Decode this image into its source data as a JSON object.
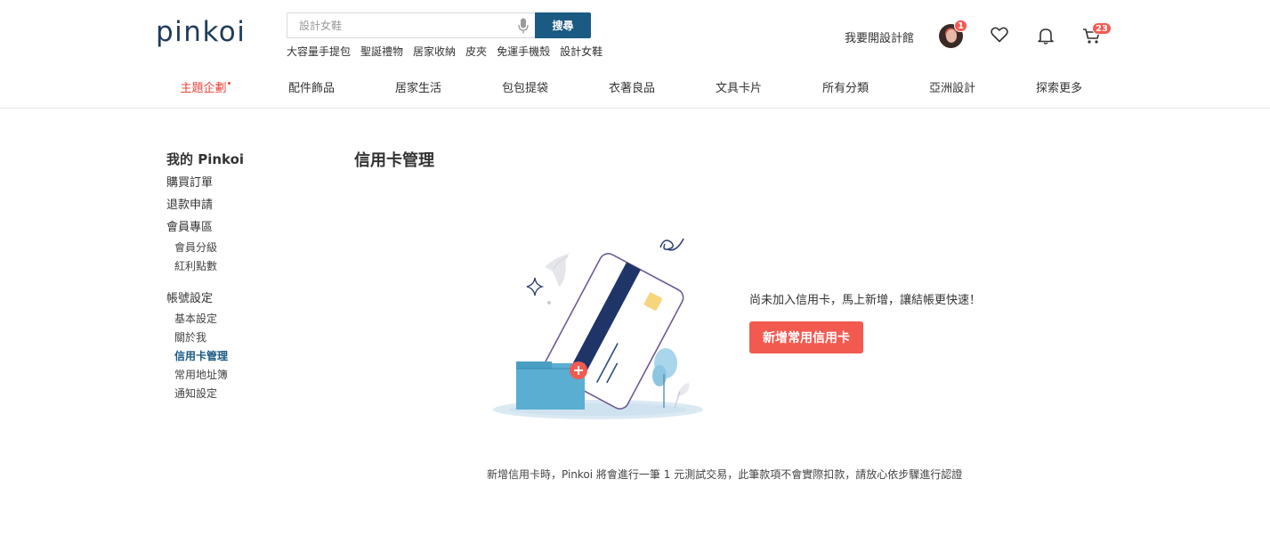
{
  "header": {
    "logo": "pinkoi",
    "search": {
      "placeholder": "設計女鞋",
      "button_label": "搜尋"
    },
    "hot_tags": [
      "大容量手提包",
      "聖誕禮物",
      "居家收納",
      "皮夾",
      "免運手機殼",
      "設計女鞋"
    ],
    "open_shop_label": "我要開設計館",
    "avatar_badge": "1",
    "cart_badge": "23",
    "icons": [
      "microphone-icon",
      "heart-icon",
      "bell-icon",
      "cart-icon"
    ]
  },
  "nav": {
    "items": [
      "主題企劃",
      "配件飾品",
      "居家生活",
      "包包提袋",
      "衣著良品",
      "文具卡片",
      "所有分類",
      "亞洲設計",
      "探索更多"
    ],
    "active_index": 0
  },
  "sidebar": {
    "title": "我的 Pinkoi",
    "groups": [
      {
        "label": "購買訂單",
        "subs": []
      },
      {
        "label": "退款申請",
        "subs": []
      },
      {
        "label": "會員專區",
        "subs": [
          "會員分級",
          "紅利點數"
        ]
      },
      {
        "label": "帳號設定",
        "subs": [
          "基本設定",
          "關於我",
          "信用卡管理",
          "常用地址簿",
          "通知設定"
        ]
      }
    ],
    "active_item": "信用卡管理"
  },
  "main": {
    "title": "信用卡管理",
    "empty_message": "尚未加入信用卡，馬上新增，讓結帳更快速！",
    "add_button_label": "新增常用信用卡",
    "footnote": "新增信用卡時，Pinkoi 將會進行一筆 1 元測試交易，此筆款項不會實際扣款，請放心依步驟進行認證"
  },
  "colors": {
    "brand_navy": "#1f3c5a",
    "search_button": "#1a5a83",
    "accent_red": "#f25a50",
    "active_nav": "#e8443a"
  }
}
